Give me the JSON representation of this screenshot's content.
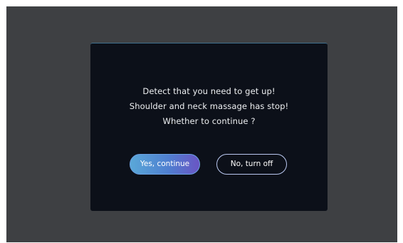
{
  "dialog": {
    "message_lines": [
      "Detect that you need to get up!",
      "Shoulder and neck massage has stop!",
      "Whether to continue ?"
    ],
    "confirm_label": "Yes, continue",
    "cancel_label": "No, turn off"
  },
  "colors": {
    "screen_background": "#3e4043",
    "dialog_background": "#0c1019",
    "confirm_gradient_start": "#5aa8d8",
    "confirm_gradient_end": "#6a55c4",
    "cancel_border": "#b9c7ef"
  }
}
